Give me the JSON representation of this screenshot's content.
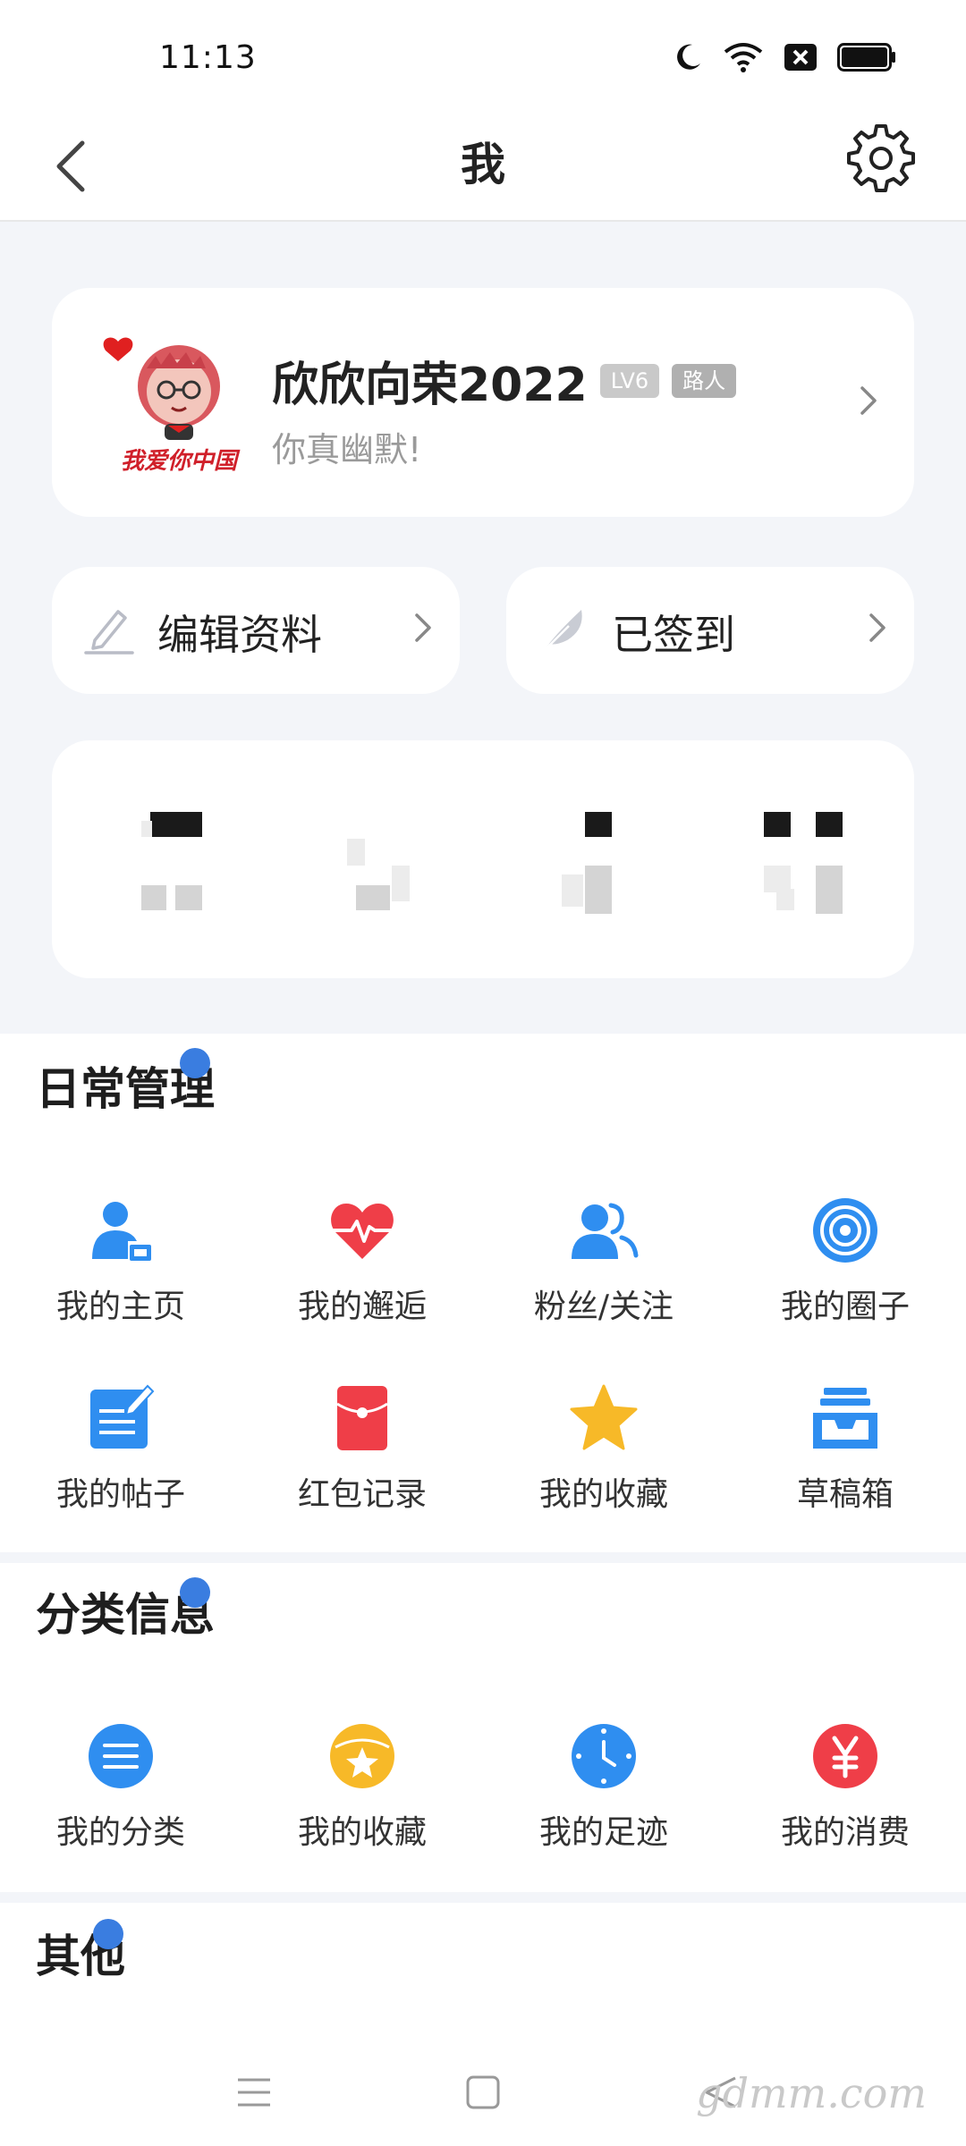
{
  "status_bar": {
    "time": "11:13"
  },
  "nav": {
    "title": "我"
  },
  "profile": {
    "name": "欣欣向荣2022",
    "level_badge": "LV6",
    "role_badge": "路人",
    "motto": "你真幽默!",
    "avatar_caption": "我爱你中国"
  },
  "quick_actions": {
    "edit_label": "编辑资料",
    "sign_label": "已签到"
  },
  "sections": {
    "daily": {
      "title": "日常管理",
      "items": [
        {
          "label": "我的主页",
          "icon": "user-home-icon"
        },
        {
          "label": "我的邂逅",
          "icon": "heartbeat-icon"
        },
        {
          "label": "粉丝/关注",
          "icon": "followers-icon"
        },
        {
          "label": "我的圈子",
          "icon": "circle-icon"
        },
        {
          "label": "我的帖子",
          "icon": "post-edit-icon"
        },
        {
          "label": "红包记录",
          "icon": "red-packet-icon"
        },
        {
          "label": "我的收藏",
          "icon": "star-icon"
        },
        {
          "label": "草稿箱",
          "icon": "drafts-inbox-icon"
        }
      ]
    },
    "category": {
      "title": "分类信息",
      "items": [
        {
          "label": "我的分类",
          "icon": "list-icon"
        },
        {
          "label": "我的收藏",
          "icon": "favorite-box-icon"
        },
        {
          "label": "我的足迹",
          "icon": "clock-icon"
        },
        {
          "label": "我的消费",
          "icon": "yuan-icon"
        }
      ]
    },
    "other": {
      "title": "其他"
    }
  },
  "watermark": "gdmm.com",
  "colors": {
    "accent_blue": "#3a9af2",
    "red": "#ef3e48",
    "yellow": "#f7b928",
    "page_gray": "#f3f5f9"
  }
}
